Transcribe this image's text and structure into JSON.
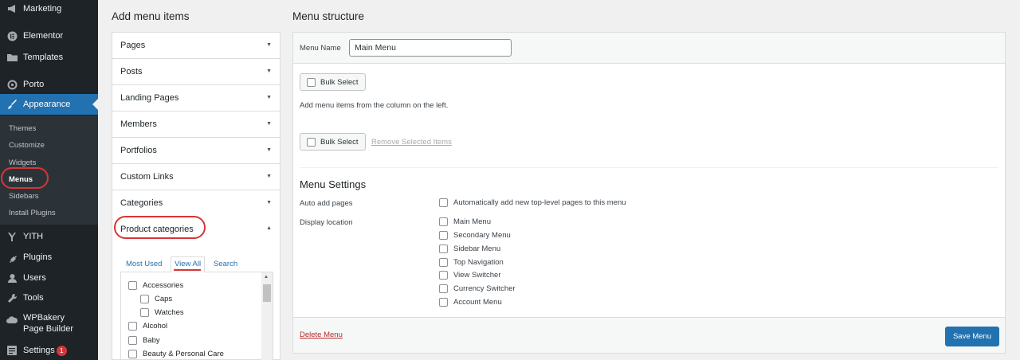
{
  "sidebar": {
    "items": [
      {
        "label": "Marketing",
        "icon": "megaphone-icon"
      },
      {
        "label": "Elementor",
        "icon": "elementor-icon"
      },
      {
        "label": "Templates",
        "icon": "folder-icon"
      },
      {
        "label": "Porto",
        "icon": "porto-icon"
      },
      {
        "label": "Appearance",
        "icon": "brush-icon"
      },
      {
        "label": "YITH",
        "icon": "yith-icon"
      },
      {
        "label": "Plugins",
        "icon": "plug-icon"
      },
      {
        "label": "Users",
        "icon": "user-icon"
      },
      {
        "label": "Tools",
        "icon": "wrench-icon"
      },
      {
        "label": "WPBakery Page Builder",
        "icon": "cloud-icon"
      },
      {
        "label": "Settings",
        "icon": "settings-icon",
        "badge": "1"
      }
    ],
    "submenu": [
      "Themes",
      "Customize",
      "Widgets",
      "Menus",
      "Sidebars",
      "Install Plugins"
    ],
    "active_color": "#2271b1"
  },
  "add_items": {
    "title": "Add menu items",
    "sections": [
      "Pages",
      "Posts",
      "Landing Pages",
      "Members",
      "Portfolios",
      "Custom Links",
      "Categories",
      "Product categories"
    ],
    "tabs": [
      "Most Used",
      "View All",
      "Search"
    ],
    "categories": [
      "Accessories",
      "Caps",
      "Watches",
      "Alcohol",
      "Baby",
      "Beauty & Personal Care"
    ]
  },
  "menu_structure": {
    "title": "Menu structure",
    "menu_name_label": "Menu Name",
    "menu_name_value": "Main Menu",
    "bulk_select": "Bulk Select",
    "hint": "Add menu items from the column on the left.",
    "remove_selected": "Remove Selected Items",
    "settings_title": "Menu Settings",
    "auto_add_label": "Auto add pages",
    "auto_add_option": "Automatically add new top-level pages to this menu",
    "display_location_label": "Display location",
    "locations": [
      "Main Menu",
      "Secondary Menu",
      "Sidebar Menu",
      "Top Navigation",
      "View Switcher",
      "Currency Switcher",
      "Account Menu"
    ],
    "delete_menu": "Delete Menu",
    "save_menu": "Save Menu"
  }
}
